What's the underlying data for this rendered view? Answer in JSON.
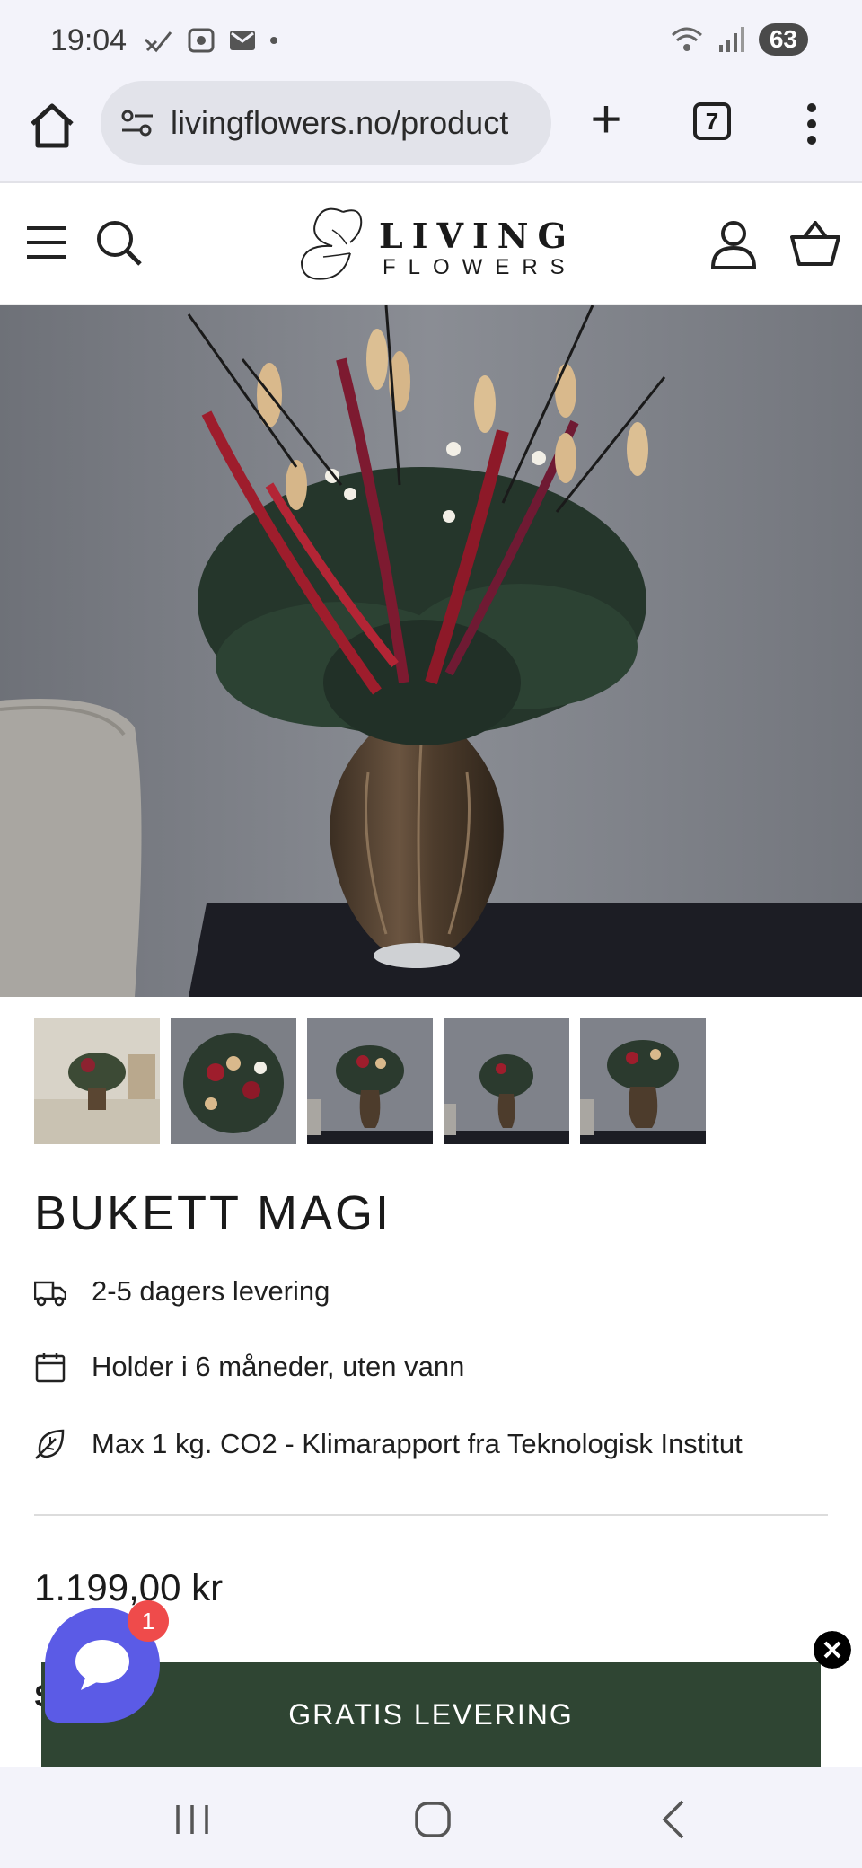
{
  "status_bar": {
    "time": "19:04",
    "battery": "63"
  },
  "browser": {
    "url": "livingflowers.no/product",
    "tabs_count": "7",
    "plus_symbol": "+"
  },
  "site": {
    "logo_top": "LIVING",
    "logo_bottom": "FLOWERS"
  },
  "product": {
    "title": "BUKETT MAGI",
    "features": [
      {
        "icon": "truck-icon",
        "text": "2-5 dagers levering"
      },
      {
        "icon": "calendar-icon",
        "text": "Holder i 6 måneder, uten vann"
      },
      {
        "icon": "leaf-icon",
        "text": "Max 1 kg. CO2 - Klimarapport fra Teknologisk Institut"
      }
    ],
    "price": "1.199,00 kr",
    "partial_label": "S"
  },
  "promo": {
    "free_delivery": "GRATIS LEVERING"
  },
  "chat": {
    "badge": "1"
  }
}
